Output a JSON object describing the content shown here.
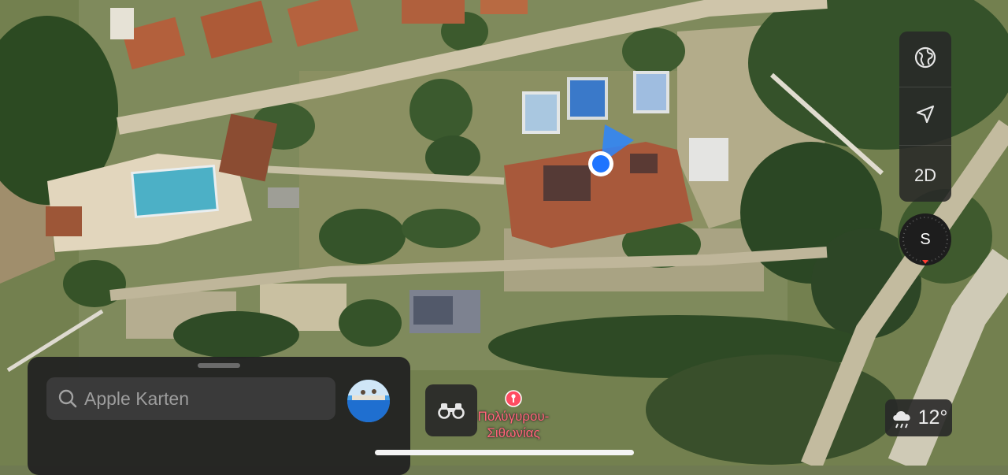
{
  "map": {
    "view_mode": "satellite",
    "user_location": {
      "accent_color": "#1e74ff",
      "heading_cone_color": "#2b86ff"
    }
  },
  "controls": {
    "globe_icon": "globe-icon",
    "location_icon": "location-arrow-icon",
    "view_toggle_label": "2D",
    "compass_label": "S",
    "compass_needle_color": "#ff3b30"
  },
  "weather": {
    "icon": "cloud-rain-icon",
    "temperature": "12°"
  },
  "search_sheet": {
    "search_placeholder": "Apple Karten",
    "search_icon": "magnifier-icon",
    "avatar": "profile-photo"
  },
  "look_around": {
    "icon": "binoculars-icon"
  },
  "poi": {
    "line1": "Πολύγυρου-",
    "line2": "Σιθωνίας",
    "pin_color": "#ff4c62"
  }
}
